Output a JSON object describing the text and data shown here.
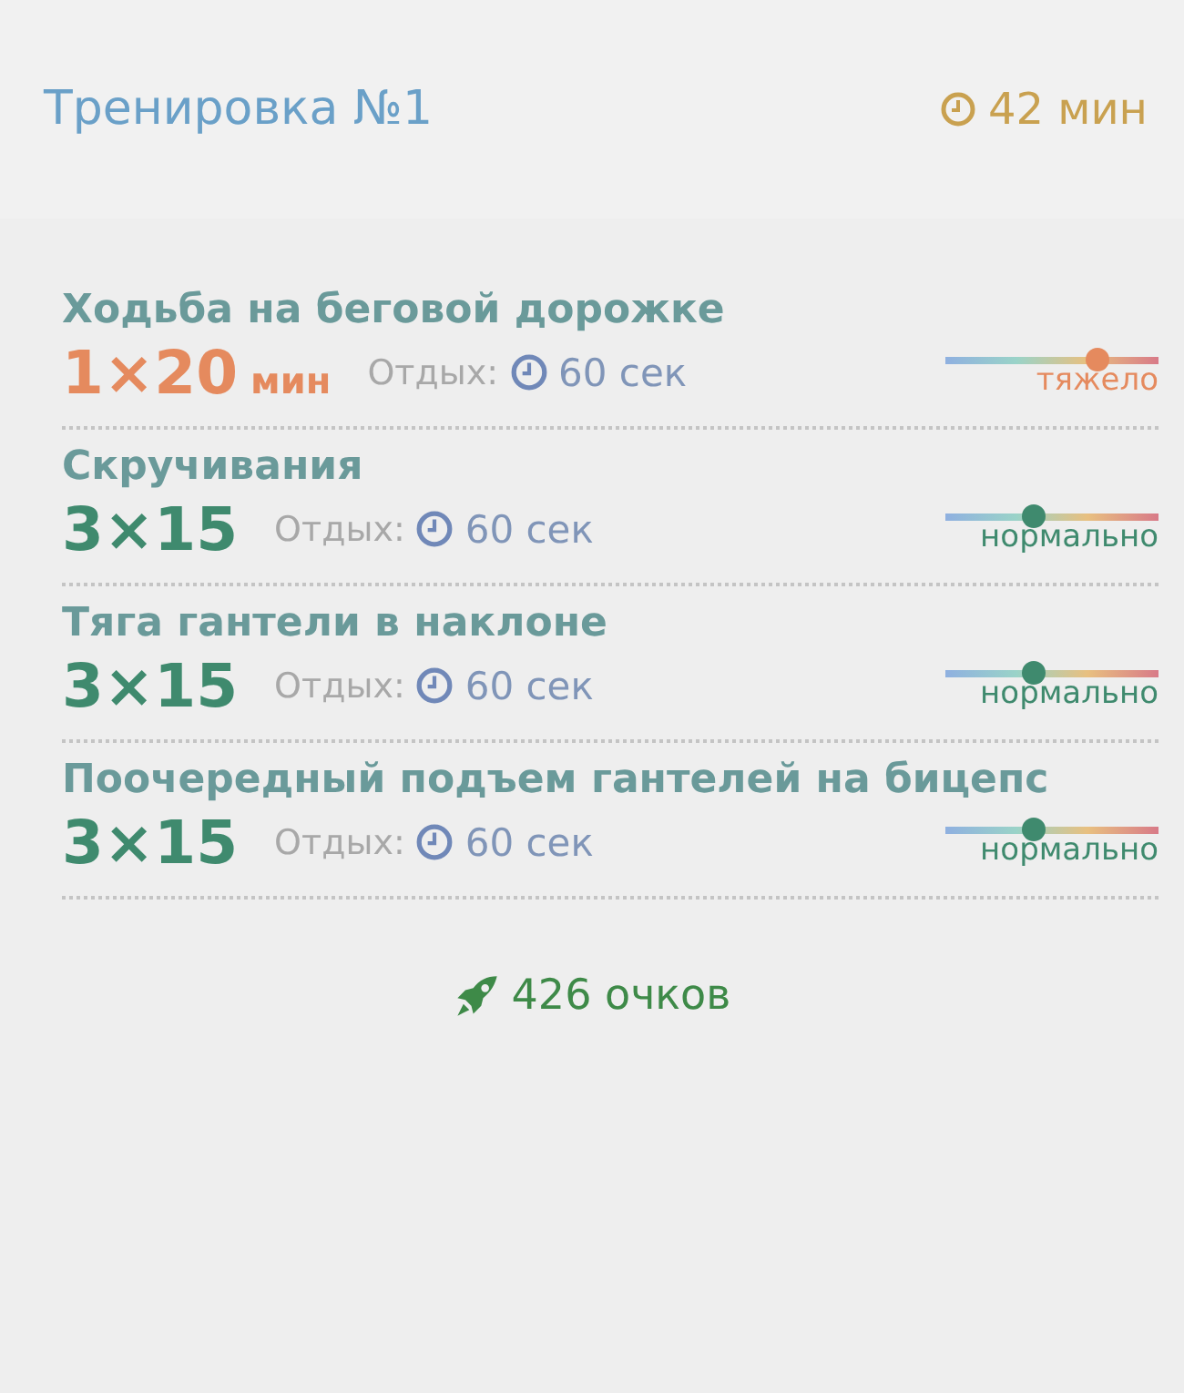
{
  "header": {
    "title": "Тренировка №1",
    "duration": "42 мин"
  },
  "exercises": [
    {
      "name": "Ходьба на беговой дорожке",
      "sets": "1×20",
      "unit": "мин",
      "rest_label": "Отдых:",
      "rest": "60 сек",
      "difficulty": {
        "kind": "hard",
        "level": 0.71,
        "label": "тяжело"
      }
    },
    {
      "name": "Скручивания",
      "sets": "3×15",
      "rest_label": "Отдых:",
      "rest": "60 сек",
      "difficulty": {
        "kind": "normal",
        "level": 0.41,
        "label": "нормально"
      }
    },
    {
      "name": "Тяга гантели в наклоне",
      "sets": "3×15",
      "rest_label": "Отдых:",
      "rest": "60 сек",
      "difficulty": {
        "kind": "normal",
        "level": 0.41,
        "label": "нормально"
      }
    },
    {
      "name": "Поочередный подъем гантелей на бицепс",
      "sets": "3×15",
      "rest_label": "Отдых:",
      "rest": "60 сек",
      "difficulty": {
        "kind": "normal",
        "level": 0.41,
        "label": "нормально"
      }
    }
  ],
  "points": "426 очков"
}
